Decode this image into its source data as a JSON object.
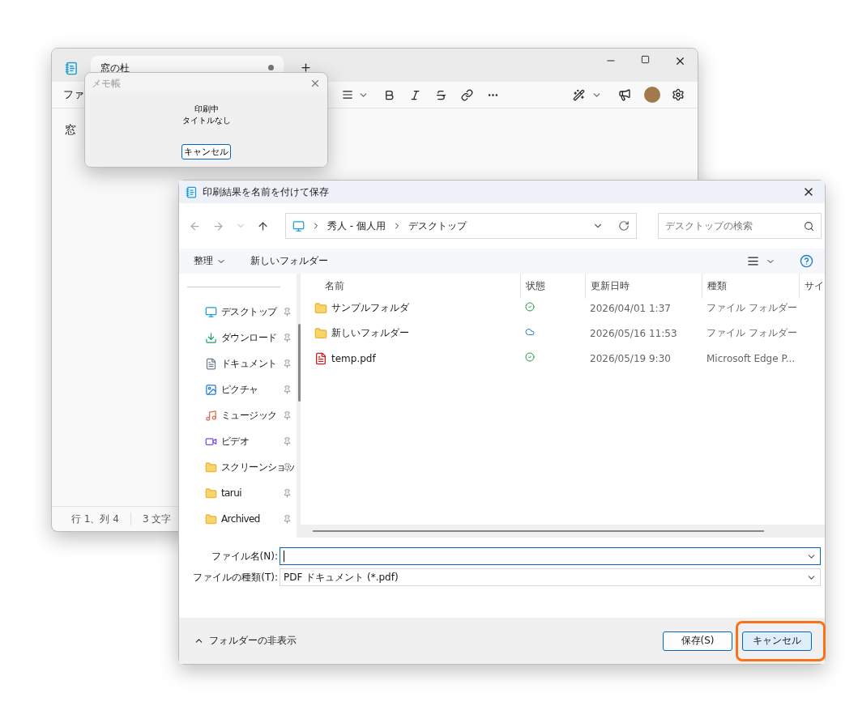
{
  "notepad": {
    "tab_title": "窓の杜",
    "tab_unsaved": true,
    "menu_partial": "ファ",
    "editor_text": "窓",
    "status": [
      "行 1、列 4",
      "3 文字"
    ]
  },
  "print_dialog": {
    "title": "メモ帳",
    "message": [
      "印刷中",
      "タイトルなし"
    ],
    "button": "キャンセル"
  },
  "save_dialog": {
    "title": "印刷結果を名前を付けて保存",
    "breadcrumb": [
      "秀人 - 個人用",
      "デスクトップ"
    ],
    "search": {
      "placeholder": "デスクトップの検索"
    },
    "toolbar": [
      "整理",
      "新しいフォルダー"
    ],
    "sidebar": [
      {
        "label": "デスクトップ",
        "kind": "desktop"
      },
      {
        "label": "ダウンロード",
        "kind": "download"
      },
      {
        "label": "ドキュメント",
        "kind": "document"
      },
      {
        "label": "ピクチャ",
        "kind": "picture"
      },
      {
        "label": "ミュージック",
        "kind": "music"
      },
      {
        "label": "ビデオ",
        "kind": "video"
      },
      {
        "label": "スクリーンショッ",
        "kind": "folder"
      },
      {
        "label": "tarui",
        "kind": "folder"
      },
      {
        "label": "Archived",
        "kind": "folder"
      }
    ],
    "columns": [
      "名前",
      "状態",
      "更新日時",
      "種類",
      "サイ"
    ],
    "rows": [
      {
        "name": "サンプルフォルダ",
        "kind": "folder",
        "status": {
          "kind": "synced"
        },
        "date": "2026/04/01 1:37",
        "type": "ファイル フォルダー"
      },
      {
        "name": "新しいフォルダー",
        "kind": "folder",
        "status": {
          "kind": "cloud"
        },
        "date": "2026/05/16 11:53",
        "type": "ファイル フォルダー"
      },
      {
        "name": "temp.pdf",
        "kind": "pdf",
        "status": {
          "kind": "synced"
        },
        "date": "2026/05/19 9:30",
        "type": "Microsoft Edge P..."
      }
    ],
    "filename": {
      "label": "ファイル名(N):"
    },
    "filetype": {
      "label": "ファイルの種類(T):",
      "value": "PDF ドキュメント (*.pdf)"
    },
    "hide_folders": "フォルダーの非表示",
    "buttons": [
      {
        "label": "保存(S)",
        "kind": "default",
        "highlighted": false
      },
      {
        "label": "キャンセル",
        "kind": "normal",
        "highlighted": true
      }
    ]
  }
}
